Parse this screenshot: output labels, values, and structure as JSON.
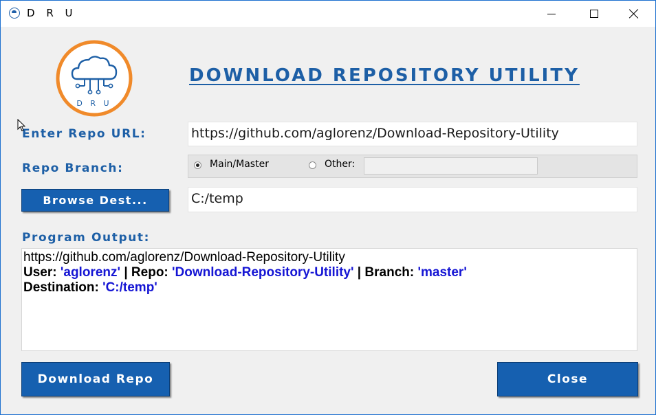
{
  "window": {
    "title": "D R U",
    "controls": {
      "minimize": "minimize-icon",
      "maximize": "maximize-icon",
      "close": "close-icon"
    }
  },
  "logo": {
    "text": "D R U",
    "ring_color": "#f08a2a",
    "cloud_color": "#1d5fa6"
  },
  "heading": "DOWNLOAD REPOSITORY UTILITY",
  "form": {
    "repo_url_label": "Enter Repo URL:",
    "repo_url_value": "https://github.com/aglorenz/Download-Repository-Utility",
    "branch_label": "Repo Branch:",
    "branch_options": [
      {
        "label": "Main/Master",
        "checked": true
      },
      {
        "label": "Other:",
        "checked": false
      }
    ],
    "other_value": "",
    "browse_button": "Browse Dest...",
    "dest_value": "C:/temp"
  },
  "output": {
    "label": "Program Output:",
    "url_line": "https://github.com/aglorenz/Download-Repository-Utility",
    "user_label": "User:",
    "user_value": "'aglorenz'",
    "sep1": "|",
    "repo_label": "Repo:",
    "repo_value": "'Download-Repository-Utility'",
    "sep2": "|",
    "branch_label": "Branch:",
    "branch_value": "'master'",
    "dest_label": "Destination:",
    "dest_value": "'C:/temp'"
  },
  "buttons": {
    "download": "Download Repo",
    "close": "Close"
  },
  "colors": {
    "accent": "#1d5fa6",
    "button_bg": "#1660b0",
    "output_value": "#1515d4",
    "logo_ring": "#f08a2a"
  }
}
